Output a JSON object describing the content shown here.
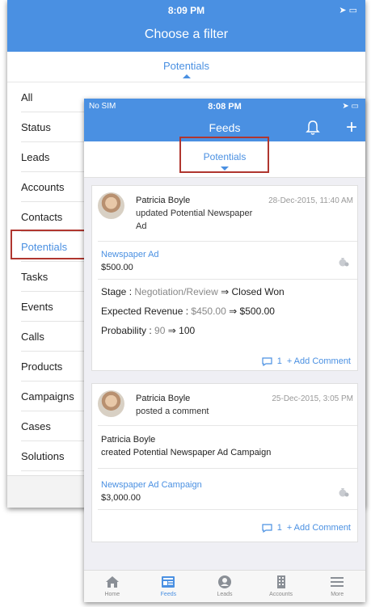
{
  "back_screen": {
    "status_time": "8:09 PM",
    "title": "Choose a filter",
    "selector_label": "Potentials",
    "filters": [
      "All",
      "Status",
      "Leads",
      "Accounts",
      "Contacts",
      "Potentials",
      "Tasks",
      "Events",
      "Calls",
      "Products",
      "Campaigns",
      "Cases",
      "Solutions"
    ],
    "active_filter": "Potentials"
  },
  "front_screen": {
    "status_left": "No SIM",
    "status_time": "8:08 PM",
    "title": "Feeds",
    "selector_label": "Potentials",
    "cards": [
      {
        "author": "Patricia Boyle",
        "date": "28-Dec-2015, 11:40 AM",
        "action": "updated Potential Newspaper Ad",
        "record_link": "Newspaper Ad",
        "record_amount": "$500.00",
        "stage_label": "Stage : ",
        "stage_old": "Negotiation/Review",
        "stage_new": "Closed Won",
        "revenue_label": "Expected Revenue : ",
        "revenue_old": "$450.00",
        "revenue_new": "$500.00",
        "probability_label": "Probability : ",
        "probability_old": "90",
        "probability_new": "100",
        "arrow": "⇒",
        "comment_count": "1",
        "add_comment": "+ Add Comment"
      },
      {
        "author": "Patricia Boyle",
        "date": "25-Dec-2015, 3:05 PM",
        "action": "posted a comment",
        "body_author": "Patricia Boyle",
        "body_prefix": "created Potential ",
        "body_record": "Newspaper Ad Campaign",
        "record_link": "Newspaper Ad Campaign",
        "record_amount": "$3,000.00",
        "comment_count": "1",
        "add_comment": "+ Add Comment"
      }
    ],
    "tabs": [
      {
        "label": "Home",
        "icon": "home-icon"
      },
      {
        "label": "Feeds",
        "icon": "feeds-icon"
      },
      {
        "label": "Leads",
        "icon": "leads-icon"
      },
      {
        "label": "Accounts",
        "icon": "accounts-icon"
      },
      {
        "label": "More",
        "icon": "menu-icon"
      }
    ],
    "active_tab": "Feeds"
  },
  "colors": {
    "brand_blue": "#4a90e2",
    "highlight_red": "#b0362f"
  }
}
